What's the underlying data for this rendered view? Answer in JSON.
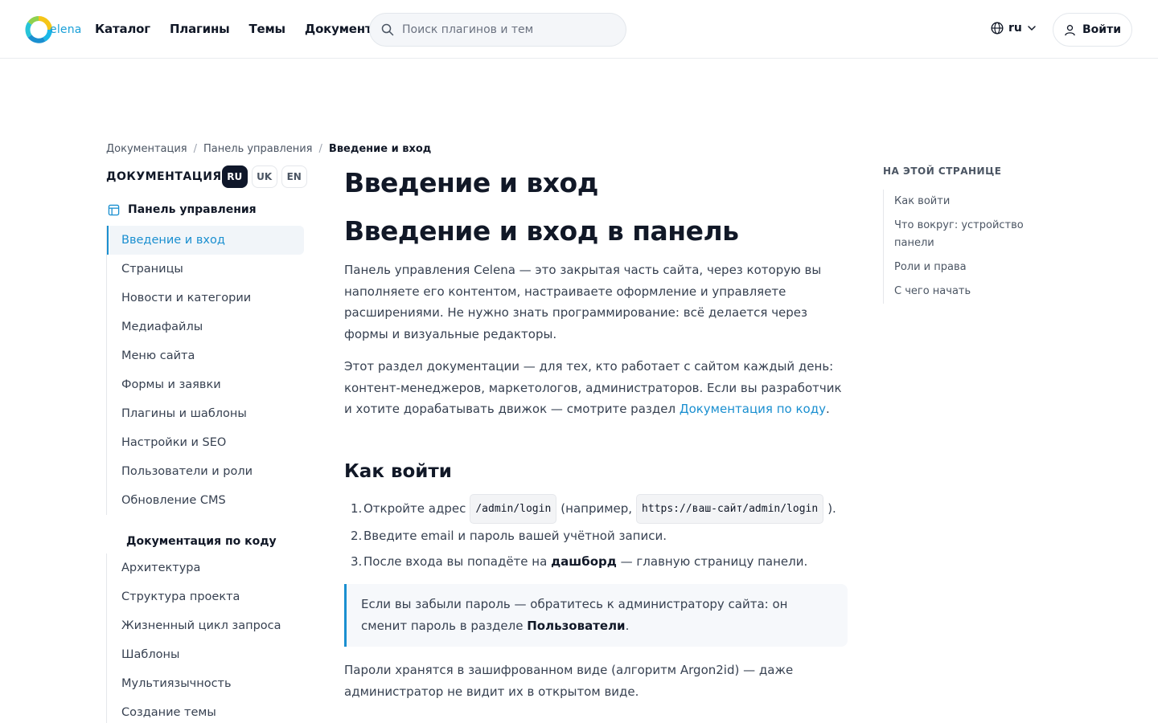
{
  "header": {
    "logo_text": "elena",
    "nav": [
      "Каталог",
      "Плагины",
      "Темы",
      "Документация"
    ],
    "search_placeholder": "Поиск плагинов и тем",
    "lang": "ru",
    "login_label": "Войти"
  },
  "breadcrumb": [
    "Документация",
    "Панель управления",
    "Введение и вход"
  ],
  "sidebar": {
    "title": "ДОКУМЕНТАЦИЯ",
    "langs": [
      "RU",
      "UK",
      "EN"
    ],
    "section1": "Панель управления",
    "items1": [
      "Введение и вход",
      "Страницы",
      "Новости и категории",
      "Медиафайлы",
      "Меню сайта",
      "Формы и заявки",
      "Плагины и шаблоны",
      "Настройки и SEO",
      "Пользователи и роли",
      "Обновление CMS"
    ],
    "section2": "Документация по коду",
    "items2": [
      "Архитектура",
      "Структура проекта",
      "Жизненный цикл запроса",
      "Шаблоны",
      "Мультиязычность",
      "Создание темы"
    ]
  },
  "main": {
    "title": "Введение и вход",
    "subtitle": "Введение и вход в панель",
    "p1": "Панель управления Celena — это закрытая часть сайта, через которую вы наполняете его контентом, настраиваете оформление и управляете расширениями. Не нужно знать программирование: всё делается через формы и визуальные редакторы.",
    "p2_text": "Этот раздел документации — для тех, кто работает с сайтом каждый день: контент-менеджеров, маркетологов, администраторов. Если вы разработчик и хотите дорабатывать движок — смотрите раздел ",
    "p2_link": "Документация по коду",
    "p2_end": ".",
    "h2": "Как войти",
    "step1_a": "Откройте адрес",
    "step1_code1": "/admin/login",
    "step1_b": "(например,",
    "step1_code2": "https://ваш-сайт/admin/login",
    "step1_c": ").",
    "step2": "Введите email и пароль вашей учётной записи.",
    "step3_a": "После входа вы попадёте на",
    "step3_bold": "дашборд",
    "step3_b": "— главную страницу панели.",
    "callout_text": "Если вы забыли пароль — обратитесь к администратору сайта: он сменит пароль в разделе ",
    "callout_bold": "Пользователи",
    "callout_end": ".",
    "p3": "Пароли хранятся в зашифрованном виде (алгоритм Argon2id) — даже администратор не видит их в открытом виде."
  },
  "toc": {
    "title": "НА ЭТОЙ СТРАНИЦЕ",
    "items": [
      "Как войти",
      "Что вокруг: устройство панели",
      "Роли и права",
      "С чего начать"
    ]
  }
}
